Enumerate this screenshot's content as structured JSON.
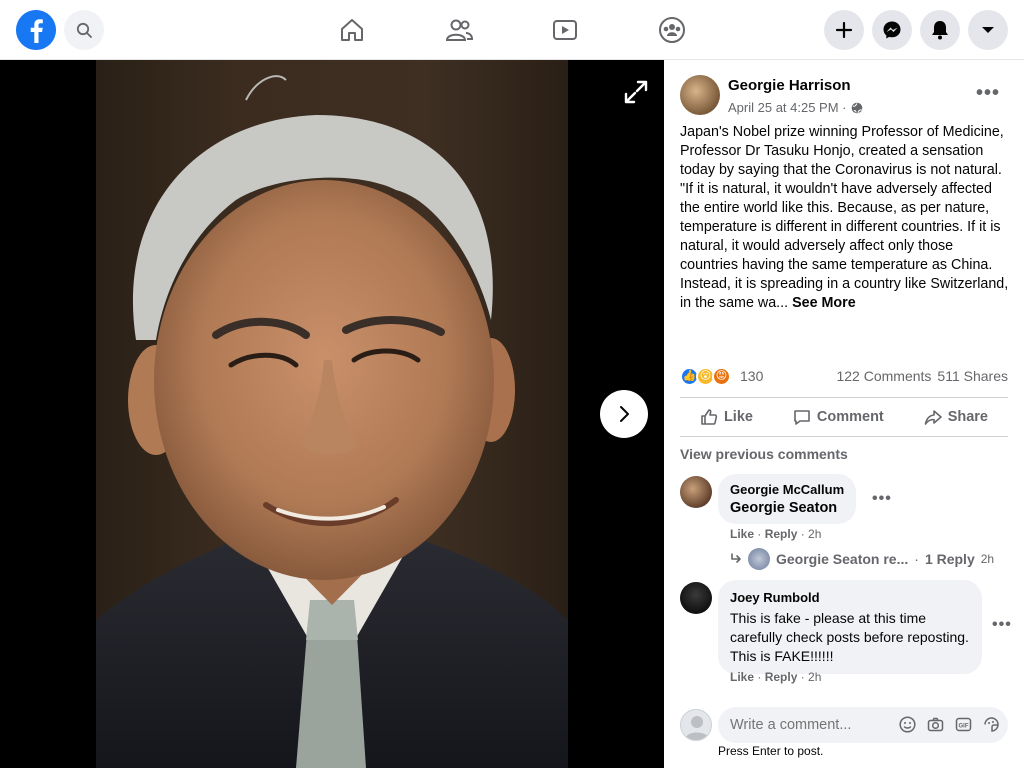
{
  "post": {
    "author": "Georgie Harrison",
    "meta": "April 25 at 4:25 PM ·",
    "text_paragraph1": "Japan's Nobel prize winning Professor of Medicine, Professor Dr Tasuku Honjo, created a sensation today by saying that the Coronavirus is not natural.",
    "text_paragraph2": "\"If it is natural, it wouldn't have adversely affected the entire world like this. Because, as per nature, temperature is different in different countries. If it is natural, it would adversely affect only those countries having the same temperature as China. Instead, it is spreading in a country like Switzerland, in the same wa...",
    "see_more": "See More",
    "reaction_count": "130",
    "comments_count": "122 Comments",
    "shares_count": "511 Shares"
  },
  "actions": {
    "like": "Like",
    "comment": "Comment",
    "share": "Share"
  },
  "comments": {
    "view_previous": "View previous comments",
    "items": [
      {
        "author": "Georgie McCallum",
        "text": "Georgie Seaton",
        "like": "Like",
        "reply": "Reply",
        "time": "2h"
      },
      {
        "author": "Joey Rumbold",
        "text": "This is fake - please at this time carefully check posts before reposting. This is FAKE!!!!!!",
        "like": "Like",
        "reply": "Reply",
        "time": "2h"
      }
    ],
    "reply_preview": {
      "author": "Georgie Seaton re...",
      "replies": "1 Reply",
      "time": "2h"
    }
  },
  "composer": {
    "placeholder": "Write a comment...",
    "hint": "Press Enter to post."
  },
  "colors": {
    "brand": "#1877f2",
    "secondary_text": "#65676b",
    "bubble": "#f0f2f5"
  },
  "icons": [
    "facebook-logo-icon",
    "search-icon",
    "home-icon",
    "friends-icon",
    "watch-icon",
    "groups-icon",
    "plus-icon",
    "messenger-icon",
    "notifications-icon",
    "account-menu-icon",
    "expand-icon",
    "next-arrow-icon",
    "globe-icon",
    "like-icon",
    "comment-icon",
    "share-icon",
    "emoji-icon",
    "camera-icon",
    "gif-icon",
    "sticker-icon"
  ]
}
